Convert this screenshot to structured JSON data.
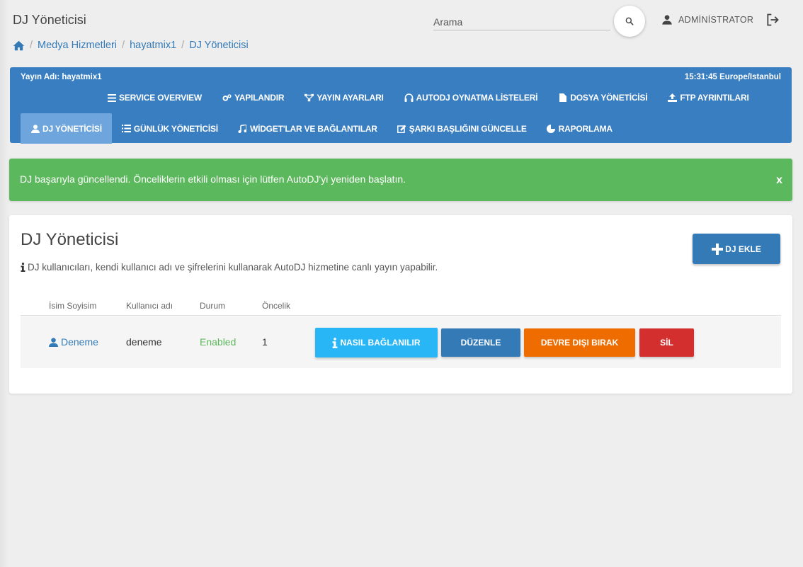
{
  "header": {
    "title": "DJ Yöneticisi",
    "search_placeholder": "Arama",
    "search_icon": "search-icon",
    "user_icon": "person-icon",
    "username": "ADMİNİSTRATOR",
    "logout_icon": "logout-icon"
  },
  "breadcrumb": {
    "home_icon": "home-icon",
    "items": [
      "Medya Hizmetleri",
      "hayatmix1",
      "DJ Yöneticisi"
    ]
  },
  "nav": {
    "stream_name": "Yayın Adı: hayatmix1",
    "time": "15:31:45 Europe/Istanbul",
    "row1": [
      {
        "label": "SERVICE OVERVIEW",
        "icon": "list-icon"
      },
      {
        "label": "YAPILANDIR",
        "icon": "gears-icon"
      },
      {
        "label": "YAYIN AYARLARI",
        "icon": "sitemap-icon"
      },
      {
        "label": "AUTODJ OYNATMA LİSTELERİ",
        "icon": "headphones-icon"
      },
      {
        "label": "DOSYA YÖNETİCİSİ",
        "icon": "file-icon"
      },
      {
        "label": "FTP AYRINTILARI",
        "icon": "upload-icon"
      }
    ],
    "row2": [
      {
        "label": "DJ YÖNETİCİSİ",
        "icon": "user-icon",
        "active": true
      },
      {
        "label": "GÜNLÜK YÖNETİCİSİ",
        "icon": "list-ul-icon"
      },
      {
        "label": "WİDGET'LAR VE BAĞLANTILAR",
        "icon": "music-icon"
      },
      {
        "label": "ŞARKI BAŞLIĞINI GÜNCELLE",
        "icon": "edit-icon"
      },
      {
        "label": "RAPORLAMA",
        "icon": "pie-chart-icon"
      }
    ]
  },
  "alert": {
    "message": "DJ başarıyla güncellendi. Önceliklerin etkili olması için lütfen AutoDJ'yi yeniden başlatın.",
    "close": "x",
    "color": "#5cb85c"
  },
  "card": {
    "title": "DJ Yöneticisi",
    "description": "DJ kullanıcıları, kendi kullanıcı adı ve şifrelerini kullanarak AutoDJ hizmetine canlı yayın yapabilir.",
    "info_icon": "info-icon",
    "add_button": "DJ EKLE",
    "add_icon": "plus-icon"
  },
  "table": {
    "headers": [
      "İsim Soyisim",
      "Kullanıcı adı",
      "Durum",
      "Öncelik"
    ],
    "rows": [
      {
        "name": "Deneme",
        "username": "deneme",
        "status": "Enabled",
        "priority": "1",
        "actions": {
          "connect": "NASIL BAĞLANILIR",
          "edit": "DÜZENLE",
          "disable": "DEVRE DIŞI BIRAK",
          "delete": "SİL"
        }
      }
    ]
  },
  "colors": {
    "primary": "#337ab7",
    "nav_bg": "#3a7ec2",
    "nav_active": "#6da5dc",
    "success": "#5cb85c",
    "info_btn": "#29b6f6",
    "warning_btn": "#ef6c00",
    "danger_btn": "#d32f2f"
  }
}
